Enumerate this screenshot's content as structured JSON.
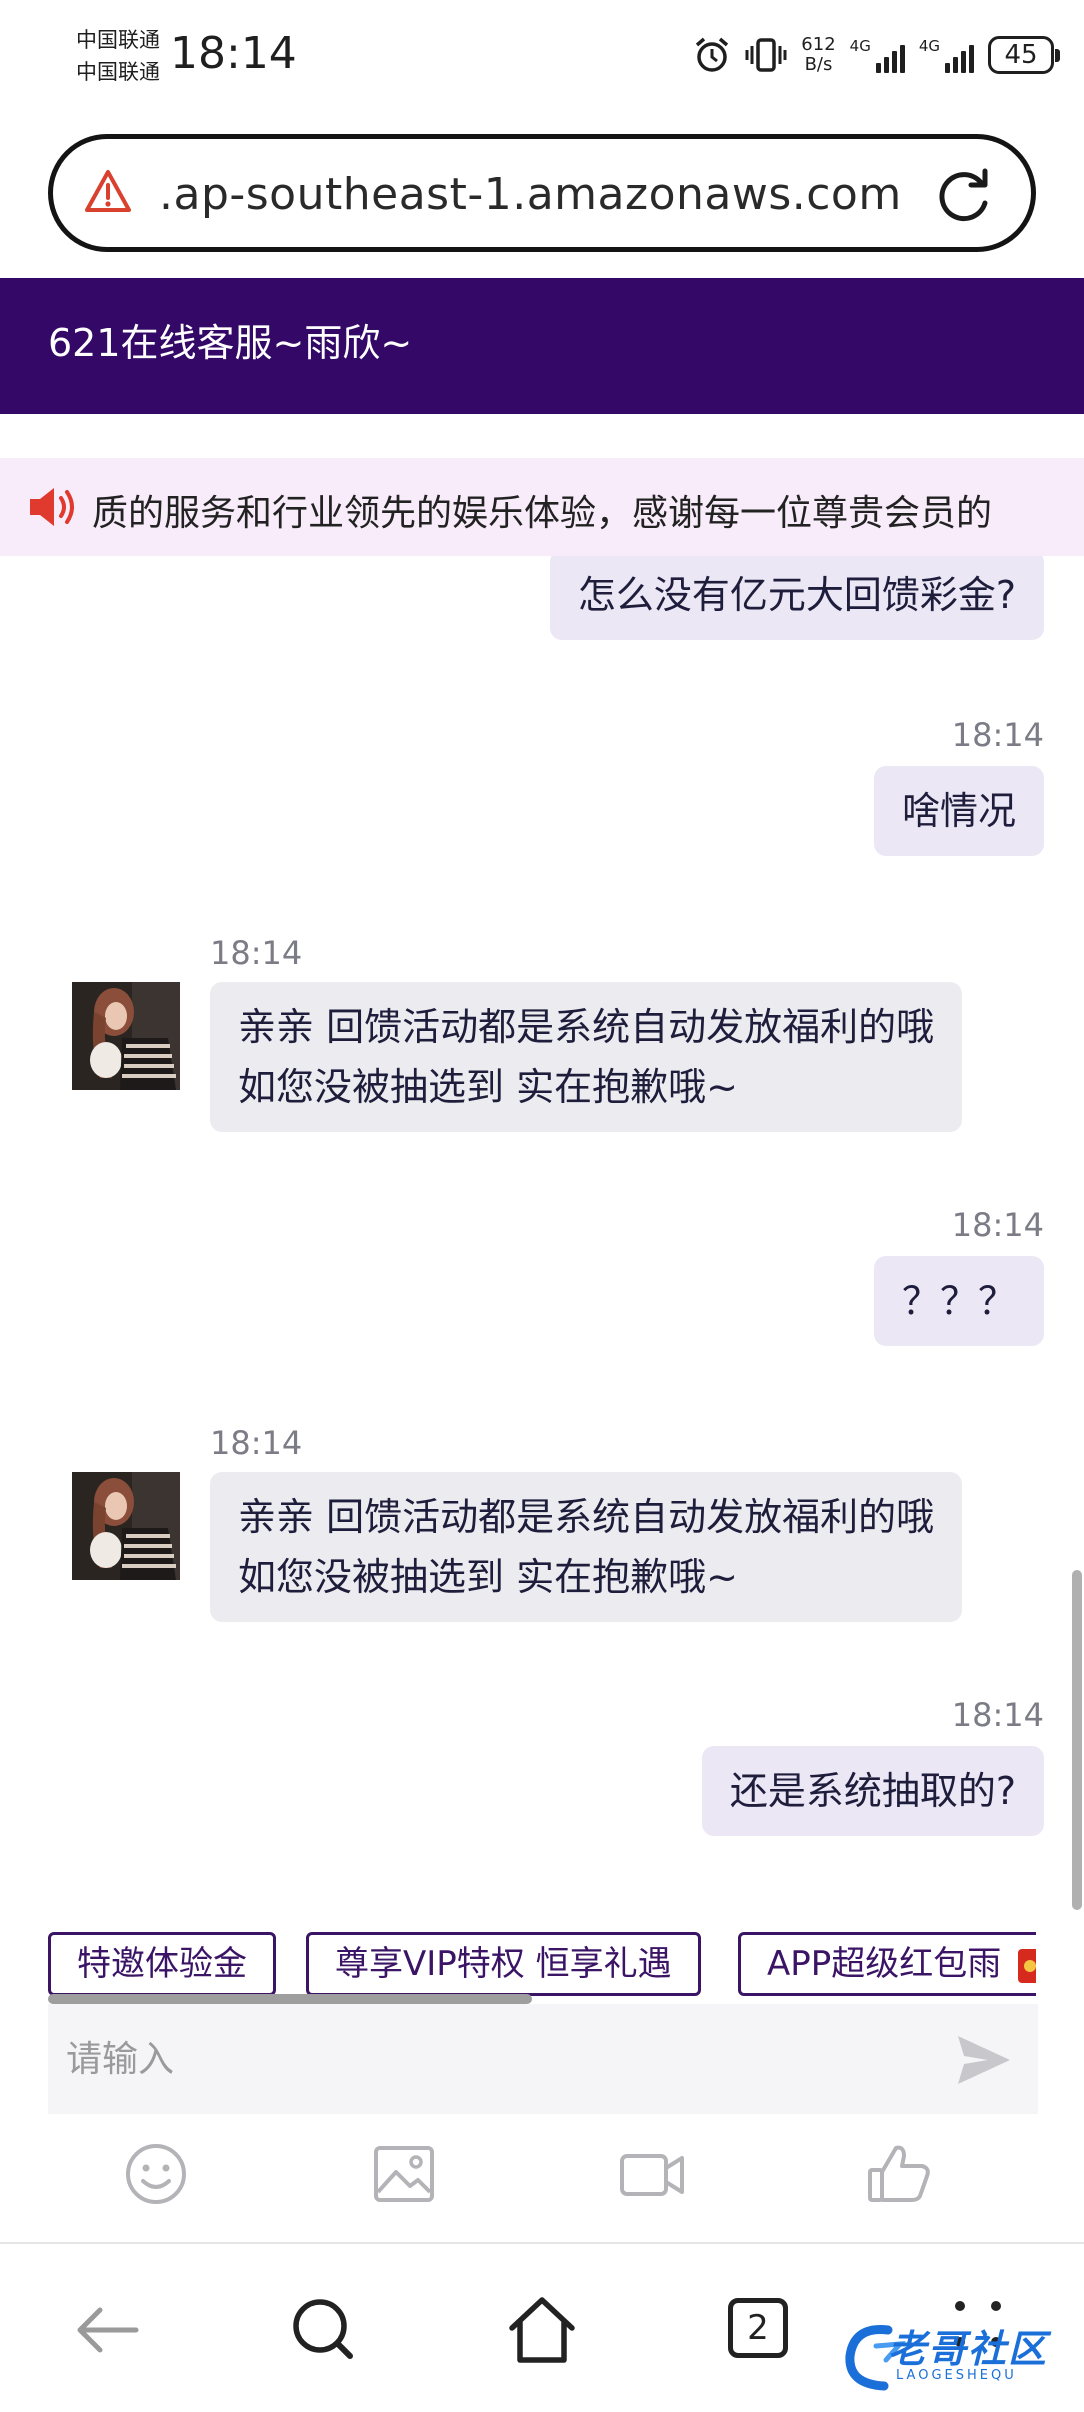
{
  "status_bar": {
    "carrier_1": "中国联通",
    "carrier_2": "中国联通",
    "time": "18:14",
    "net_speed_value": "612",
    "net_speed_unit": "B/s",
    "network_1": "4G",
    "network_2": "4G",
    "battery": "45"
  },
  "browser": {
    "url": ".ap-southeast-1.amazonaws.com",
    "tab_count": "2"
  },
  "chat": {
    "title": "621在线客服~雨欣~",
    "notice": "质的服务和行业领先的娱乐体验，感谢每一位尊贵会员的",
    "messages": [
      {
        "from": "me",
        "text": "怎么没有亿元大回馈彩金?"
      },
      {
        "from": "me",
        "time": "18:14",
        "text": "啥情况"
      },
      {
        "from": "agent",
        "time": "18:14",
        "line1": "亲亲 回馈活动都是系统自动发放福利的哦",
        "line2": "如您没被抽选到 实在抱歉哦~"
      },
      {
        "from": "me",
        "time": "18:14",
        "text": "？？？"
      },
      {
        "from": "agent",
        "time": "18:14",
        "line1": "亲亲 回馈活动都是系统自动发放福利的哦",
        "line2": "如您没被抽选到 实在抱歉哦~"
      },
      {
        "from": "me",
        "time": "18:14",
        "text": "还是系统抽取的?"
      }
    ],
    "quick_replies": [
      "特邀体验金",
      "尊享VIP特权 恒享礼遇",
      "APP超级红包雨"
    ],
    "input_placeholder": "请输入"
  },
  "watermark": {
    "text": "老哥社区",
    "sub": "LAOGESHEQU"
  },
  "colors": {
    "header_bg": "#330867",
    "notice_bg": "#f8ecfa",
    "my_bubble": "#ece7f5",
    "agent_bubble": "#ececf0",
    "chip_border": "#3b1466"
  }
}
